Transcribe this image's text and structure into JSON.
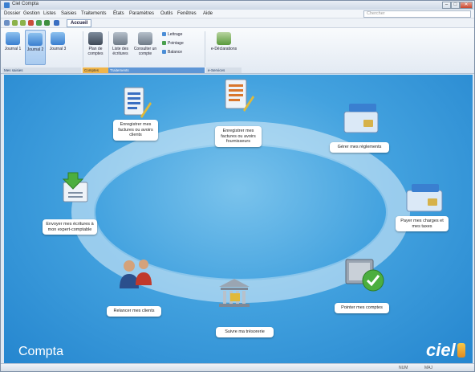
{
  "window": {
    "title": "Ciel Compta",
    "btn_min": "–",
    "btn_max": "□",
    "btn_close": "✕"
  },
  "menu": [
    "Dossier",
    "Gestion",
    "Listes",
    "Saisies",
    "Traitements",
    "États",
    "Paramètres",
    "Outils",
    "Fenêtres",
    "Aide"
  ],
  "search_placeholder": "Chercher",
  "quickbar": {
    "tab_label": "Accueil"
  },
  "ribbon": {
    "buttons": [
      {
        "label": "Journal 1"
      },
      {
        "label": "Journal 2"
      },
      {
        "label": "Journal 3"
      },
      {
        "label": "Plan de comptes"
      },
      {
        "label": "Liste des écritures"
      },
      {
        "label": "Consulter un compte"
      },
      {
        "label": "e-Déclarations"
      }
    ],
    "small": [
      "Lettrage",
      "Pointage",
      "Balance"
    ],
    "groups": [
      "Mes saisies",
      "Comptes",
      "Traitements",
      "e-Services"
    ]
  },
  "workflow": [
    {
      "text": "Enregistrer mes factures ou avoirs clients"
    },
    {
      "text": "Enregistrer mes factures ou avoirs fournisseurs"
    },
    {
      "text": "Gérer mes règlements"
    },
    {
      "text": "Payer mes charges et mes taxes"
    },
    {
      "text": "Pointer mes comptes"
    },
    {
      "text": "Suivre ma trésorerie"
    },
    {
      "text": "Relancer mes clients"
    },
    {
      "text": "Envoyer mes écritures à mon expert-comptable"
    }
  ],
  "module_name": "Compta",
  "brand": "ciel",
  "status": {
    "left": "",
    "right1": "NUM",
    "right2": "MAJ"
  },
  "colors": {
    "background": "#2f93d8",
    "accent": "#5e96d6",
    "brand_mark": "#f0a830"
  }
}
